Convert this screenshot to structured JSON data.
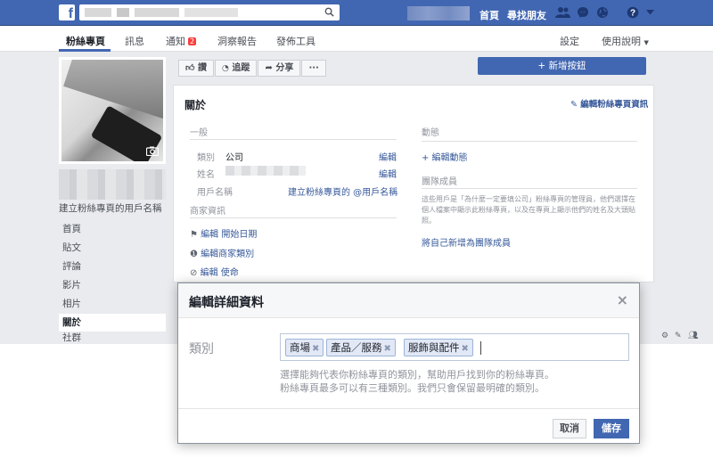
{
  "topbar": {
    "logo": "f",
    "nav_home": "首頁",
    "nav_find_friends": "尋找朋友",
    "icons": [
      "friends-icon",
      "messenger-icon",
      "globe-icon",
      "help-icon",
      "caret-down-icon"
    ]
  },
  "page_tabs": {
    "items": [
      "粉絲專頁",
      "訊息",
      "通知",
      "洞察報告",
      "發佈工具"
    ],
    "notification_count": "2",
    "settings": "設定",
    "help": "使用說明"
  },
  "sidebar": {
    "username_link": "建立粉絲專頁的用戶名稱",
    "items": [
      "首頁",
      "貼文",
      "評論",
      "影片",
      "相片",
      "關於",
      "社群"
    ],
    "active_index": 5
  },
  "action_bar": {
    "like": "讚",
    "follow": "追蹤",
    "share": "分享",
    "more": "···",
    "add_button": "+ 新增按鈕"
  },
  "about": {
    "title": "關於",
    "edit_page_info": "編輯粉絲專頁資訊",
    "general_heading": "一般",
    "category_label": "類別",
    "category_value": "公司",
    "name_label": "姓名",
    "username_label": "用戶名稱",
    "edit": "編輯",
    "create_username": "建立粉絲專頁的 @用戶名稱",
    "business_info_heading": "商家資訊",
    "edit_start_date": "編輯 開始日期",
    "edit_business_type": "編輯商家類別",
    "edit_mission": "編輯 使命",
    "milestones_heading": "動態",
    "edit_milestones": "+ 編輯動態",
    "team_heading": "團隊成員",
    "team_desc": "這些用戶是「為什麼一定要填公司」粉絲專頁的管理員，他們選擇在個人檔案中顯示此粉絲專頁，以及在專頁上顯示他們的姓名及大頭貼照。",
    "add_self": "將自己新增為團隊成員"
  },
  "dialog": {
    "title": "編輯詳細資料",
    "close": "×",
    "field_label": "類別",
    "tags": [
      "商場",
      "產品／服務",
      "服飾與配件"
    ],
    "help_line1": "選擇能夠代表你粉絲專頁的類別，幫助用戶找到你的粉絲專頁。",
    "help_line2": "粉絲專頁最多可以有三種類別。我們只會保留最明確的類別。",
    "cancel": "取消",
    "save": "儲存"
  }
}
